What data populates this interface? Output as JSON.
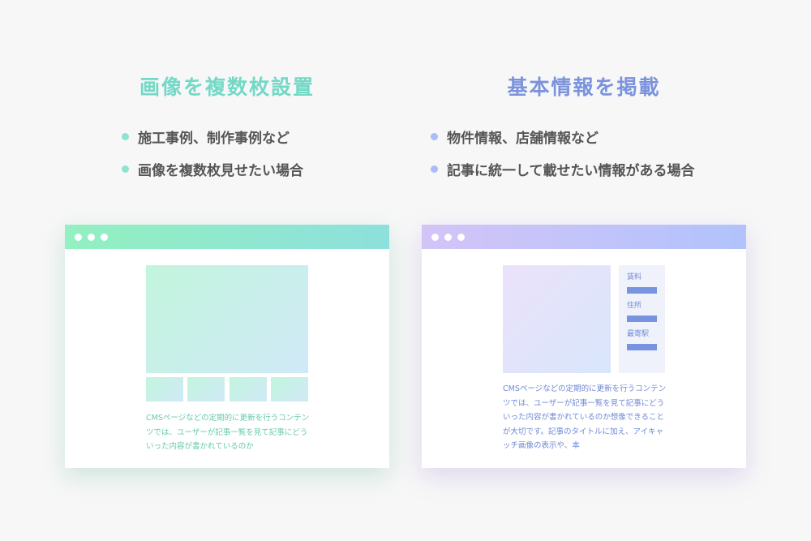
{
  "left": {
    "title": "画像を複数枚設置",
    "bullets": [
      "施工事例、制作事例など",
      "画像を複数枚見せたい場合"
    ],
    "accent": "#73d9c7",
    "window": {
      "text": "CMSページなどの定期的に更新を行うコンテンツでは、ユーザーが記事一覧を見て記事にどういった内容が書かれているのか"
    }
  },
  "right": {
    "title": "基本情報を掲載",
    "bullets": [
      "物件情報、店舗情報など",
      "記事に統一して載せたい情報がある場合"
    ],
    "accent": "#7b93dd",
    "window": {
      "info_labels": [
        "賃料",
        "住所",
        "最寄駅"
      ],
      "text": "CMSページなどの定期的に更新を行うコンテンツでは、ユーザーが記事一覧を見て記事にどういった内容が書かれているのか想像できることが大切です。記事のタイトルに加え、アイキャッチ画像の表示や、本"
    }
  }
}
